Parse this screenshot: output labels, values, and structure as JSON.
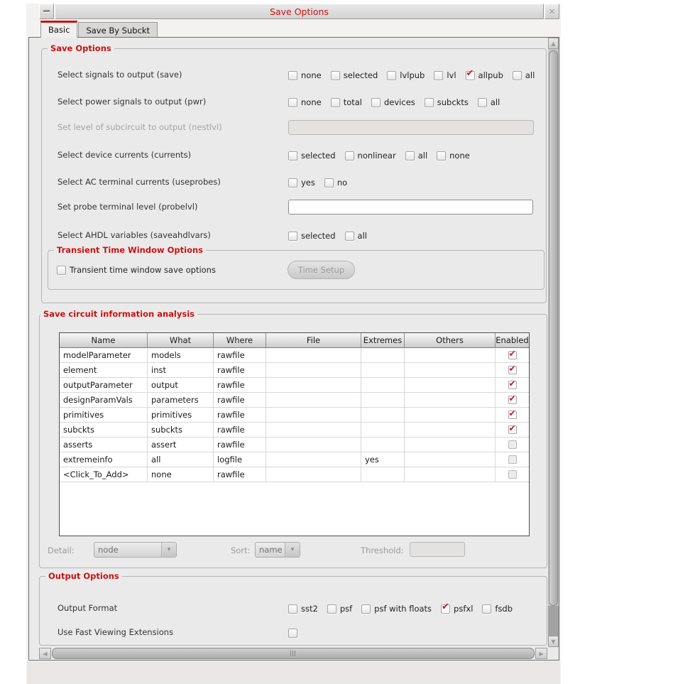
{
  "colors": {
    "accent_red": "#cc1111",
    "check_red": "#c9171e",
    "content_bg": "#ebeaea"
  },
  "icons": {
    "minimize": "minimize-dash",
    "close": "✕",
    "dropdown_arrow": "▾",
    "scroll_up": "▲",
    "scroll_down": "▼",
    "scroll_left": "◀",
    "scroll_right": "▶",
    "check": "✔"
  },
  "window": {
    "title": "Save Options"
  },
  "tabs": {
    "basic": "Basic",
    "save_by_subckt": "Save By Subckt"
  },
  "save_options": {
    "title": "Save Options",
    "signals_label": "Select signals to output (save)",
    "signals_options": [
      {
        "label": "none",
        "checked": false
      },
      {
        "label": "selected",
        "checked": false
      },
      {
        "label": "lvlpub",
        "checked": false
      },
      {
        "label": "lvl",
        "checked": false
      },
      {
        "label": "allpub",
        "checked": true
      },
      {
        "label": "all",
        "checked": false
      }
    ],
    "power_label": "Select power signals to output (pwr)",
    "power_options": [
      {
        "label": "none",
        "checked": false
      },
      {
        "label": "total",
        "checked": false
      },
      {
        "label": "devices",
        "checked": false
      },
      {
        "label": "subckts",
        "checked": false
      },
      {
        "label": "all",
        "checked": false
      }
    ],
    "nestlvl_label": "Set level of subcircuit to output (nestlvl)",
    "nestlvl_value": "",
    "currents_label": "Select device currents (currents)",
    "currents_options": [
      {
        "label": "selected",
        "checked": false
      },
      {
        "label": "nonlinear",
        "checked": false
      },
      {
        "label": "all",
        "checked": false
      },
      {
        "label": "none",
        "checked": false
      }
    ],
    "useprobes_label": "Select AC terminal currents (useprobes)",
    "useprobes_options": [
      {
        "label": "yes",
        "checked": false
      },
      {
        "label": "no",
        "checked": false
      }
    ],
    "probelvl_label": "Set probe terminal level (probelvl)",
    "probelvl_value": "",
    "ahdl_label": "Select AHDL variables (saveahdlvars)",
    "ahdl_options": [
      {
        "label": "selected",
        "checked": false
      },
      {
        "label": "all",
        "checked": false
      }
    ]
  },
  "transient": {
    "title": "Transient Time Window Options",
    "checkbox_label": "Transient time window save options",
    "checked": false,
    "time_setup_label": "Time Setup"
  },
  "circuit_info": {
    "title": "Save circuit information analysis",
    "table": {
      "headers": [
        "Name",
        "What",
        "Where",
        "File",
        "Extremes",
        "Others",
        "Enabled"
      ],
      "rows": [
        {
          "name": "modelParameter",
          "what": "models",
          "where": "rawfile",
          "file": "",
          "extremes": "",
          "others": "",
          "enabled": true
        },
        {
          "name": "element",
          "what": "inst",
          "where": "rawfile",
          "file": "",
          "extremes": "",
          "others": "",
          "enabled": true
        },
        {
          "name": "outputParameter",
          "what": "output",
          "where": "rawfile",
          "file": "",
          "extremes": "",
          "others": "",
          "enabled": true
        },
        {
          "name": "designParamVals",
          "what": "parameters",
          "where": "rawfile",
          "file": "",
          "extremes": "",
          "others": "",
          "enabled": true
        },
        {
          "name": "primitives",
          "what": "primitives",
          "where": "rawfile",
          "file": "",
          "extremes": "",
          "others": "",
          "enabled": true
        },
        {
          "name": "subckts",
          "what": "subckts",
          "where": "rawfile",
          "file": "",
          "extremes": "",
          "others": "",
          "enabled": true
        },
        {
          "name": "asserts",
          "what": "assert",
          "where": "rawfile",
          "file": "",
          "extremes": "",
          "others": "",
          "enabled": false
        },
        {
          "name": "extremeinfo",
          "what": "all",
          "where": "logfile",
          "file": "",
          "extremes": "yes",
          "others": "",
          "enabled": false
        },
        {
          "name": "<Click_To_Add>",
          "what": "none",
          "where": "rawfile",
          "file": "",
          "extremes": "",
          "others": "",
          "enabled": false
        }
      ]
    },
    "detail_label": "Detail:",
    "detail_value": "node",
    "sort_label": "Sort:",
    "sort_value": "name",
    "threshold_label": "Threshold:",
    "threshold_value": ""
  },
  "output_options": {
    "title": "Output Options",
    "format_label": "Output Format",
    "format_options": [
      {
        "label": "sst2",
        "checked": false
      },
      {
        "label": "psf",
        "checked": false
      },
      {
        "label": "psf with floats",
        "checked": false
      },
      {
        "label": "psfxl",
        "checked": true
      },
      {
        "label": "fsdb",
        "checked": false
      }
    ],
    "fast_viewing_label": "Use Fast Viewing Extensions",
    "fast_viewing_checked": false
  }
}
